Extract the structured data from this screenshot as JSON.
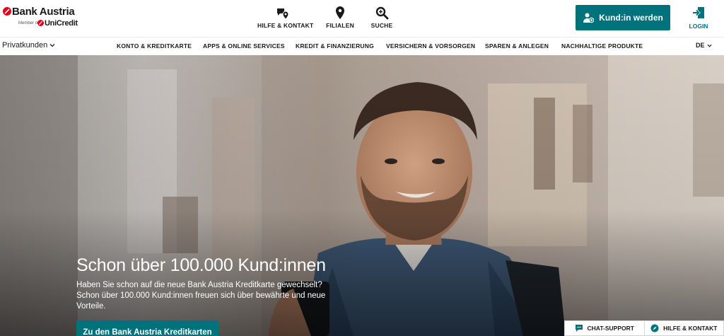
{
  "brand": {
    "name": "Bank Austria",
    "member_of": "Member of",
    "parent": "UniCredit",
    "red": "#e2001a"
  },
  "quick_links": {
    "hilfe": {
      "label": "HILFE & KONTAKT",
      "icon": "chat-location-icon"
    },
    "filialen": {
      "label": "FILIALEN",
      "icon": "map-pin-icon"
    },
    "suche": {
      "label": "SUCHE",
      "icon": "search-icon"
    }
  },
  "cta_top": {
    "label": "Kund:in werden",
    "icon": "user-add-icon",
    "color": "#00727c"
  },
  "login": {
    "label": "LOGIN",
    "icon": "login-icon"
  },
  "nav": {
    "segment": "Privatkunden",
    "items": [
      "KONTO & KREDITKARTE",
      "APPS & ONLINE SERVICES",
      "KREDIT & FINANZIERUNG",
      "VERSICHERN & VORSORGEN",
      "SPAREN & ANLEGEN",
      "NACHHALTIGE PRODUKTE"
    ],
    "language": "DE"
  },
  "hero": {
    "title": "Schon über 100.000 Kund:innen",
    "text": "Haben Sie schon auf die neue Bank Austria Kreditkarte gewechselt? Schon über 100.000 Kund:innen freuen sich über bewährte und neue Vorteile.",
    "button": "Zu den Bank Austria Kreditkarten"
  },
  "floating": {
    "chat": "CHAT-SUPPORT",
    "hilfe": "HILFE & KONTAKT"
  }
}
